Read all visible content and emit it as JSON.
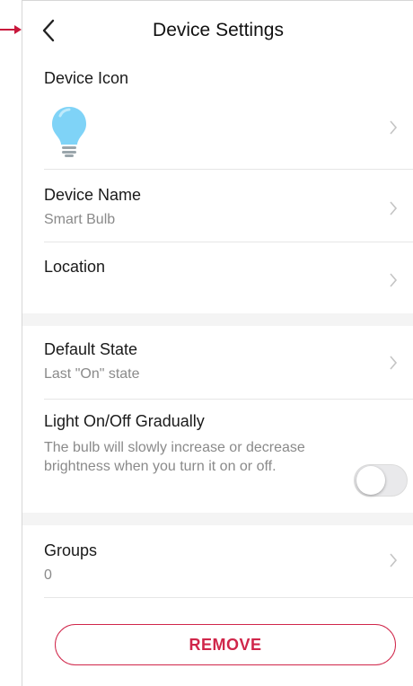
{
  "header": {
    "title": "Device Settings"
  },
  "device_icon": {
    "label": "Device Icon",
    "icon": "light-bulb-icon"
  },
  "device_name": {
    "label": "Device Name",
    "value": "Smart Bulb"
  },
  "location": {
    "label": "Location",
    "value": ""
  },
  "default_state": {
    "label": "Default State",
    "value": "Last \"On\" state"
  },
  "gradual": {
    "label": "Light On/Off Gradually",
    "description": "The bulb will slowly increase or decrease brightness when you turn it on or off.",
    "enabled": false
  },
  "groups": {
    "label": "Groups",
    "value": "0"
  },
  "remove": {
    "label": "REMOVE"
  },
  "colors": {
    "accent": "#d0264a",
    "bulb": "#7fd3f7"
  }
}
